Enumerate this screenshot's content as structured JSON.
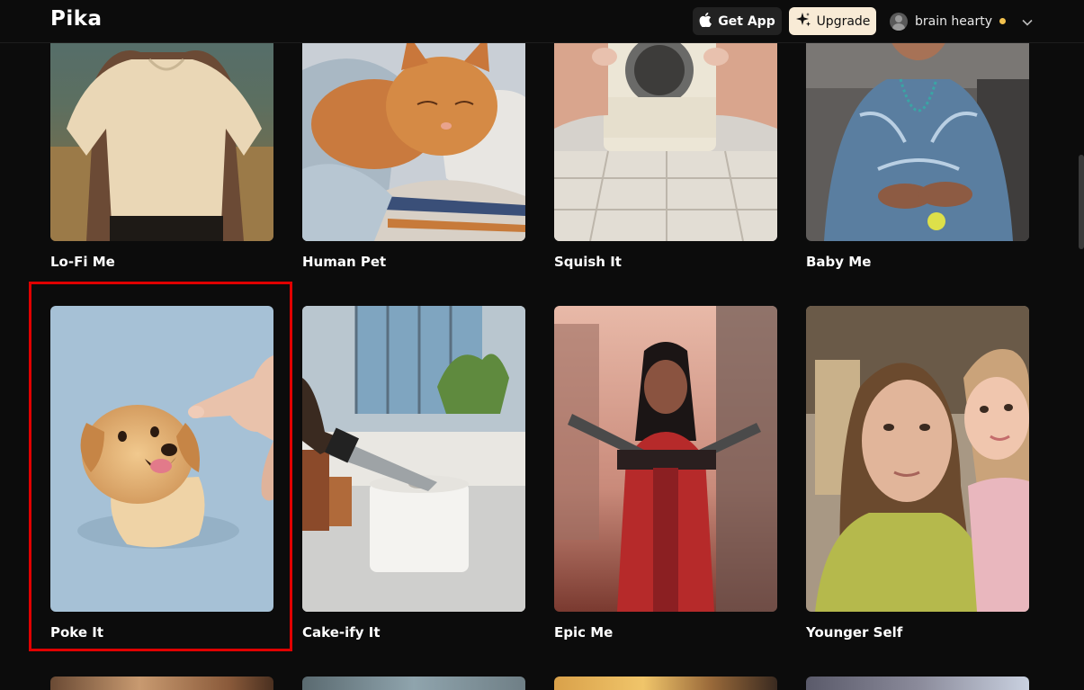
{
  "header": {
    "logo": "Pika",
    "get_app_label": "Get App",
    "upgrade_label": "Upgrade",
    "username": "brain hearty"
  },
  "icons": {
    "get_app": "apple-icon",
    "upgrade": "sparkle-icon",
    "user": "avatar-icon",
    "menu": "chevron-down-icon"
  },
  "colors": {
    "accent_upgrade": "#f8ebd6",
    "status_dot": "#f2c14e",
    "selection_outline": "#e00000"
  },
  "effects": [
    {
      "title": "Lo-Fi Me"
    },
    {
      "title": "Human Pet"
    },
    {
      "title": "Squish It"
    },
    {
      "title": "Baby Me"
    },
    {
      "title": "Poke It"
    },
    {
      "title": "Cake-ify It"
    },
    {
      "title": "Epic Me"
    },
    {
      "title": "Younger Self"
    }
  ],
  "selected_effect": "Poke It"
}
